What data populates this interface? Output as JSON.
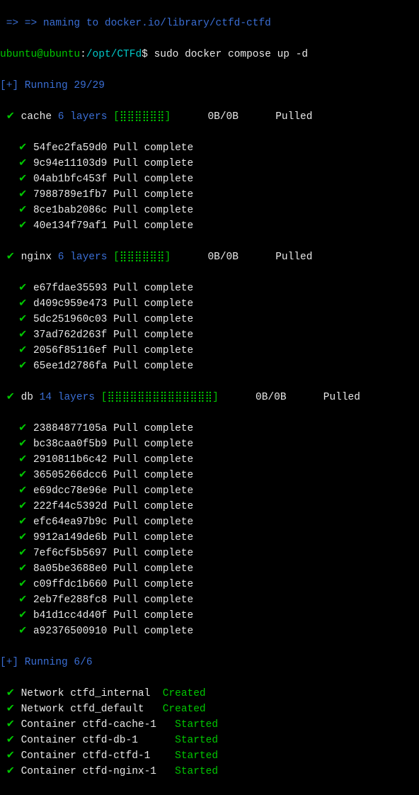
{
  "header": {
    "naming": " => => naming to docker.io/library/ctfd-ctfd",
    "prompt_user": "ubuntu",
    "prompt_at": "@",
    "prompt_host": "ubuntu",
    "prompt_colon": ":",
    "prompt_path": "/opt/CTFd",
    "prompt_dollar": "$ ",
    "command": "sudo docker compose up -d"
  },
  "run1": {
    "text": "[+] Running 29/29"
  },
  "svc": {
    "cache": {
      "name": "cache",
      "layers": "6 layers",
      "bar": "[⣿⣿⣿⣿⣿⣿]",
      "bytes": "0B/0B",
      "status": "Pulled"
    },
    "nginx": {
      "name": "nginx",
      "layers": "6 layers",
      "bar": "[⣿⣿⣿⣿⣿⣿]",
      "bytes": "0B/0B",
      "status": "Pulled"
    },
    "db": {
      "name": "db",
      "layers": "14 layers",
      "bar": "[⣿⣿⣿⣿⣿⣿⣿⣿⣿⣿⣿⣿⣿⣿]",
      "bytes": "0B/0B",
      "status": "Pulled"
    }
  },
  "cache_layers": [
    {
      "id": "54fec2fa59d0",
      "status": "Pull complete"
    },
    {
      "id": "9c94e11103d9",
      "status": "Pull complete"
    },
    {
      "id": "04ab1bfc453f",
      "status": "Pull complete"
    },
    {
      "id": "7988789e1fb7",
      "status": "Pull complete"
    },
    {
      "id": "8ce1bab2086c",
      "status": "Pull complete"
    },
    {
      "id": "40e134f79af1",
      "status": "Pull complete"
    }
  ],
  "nginx_layers": [
    {
      "id": "e67fdae35593",
      "status": "Pull complete"
    },
    {
      "id": "d409c959e473",
      "status": "Pull complete"
    },
    {
      "id": "5dc251960c03",
      "status": "Pull complete"
    },
    {
      "id": "37ad762d263f",
      "status": "Pull complete"
    },
    {
      "id": "2056f85116ef",
      "status": "Pull complete"
    },
    {
      "id": "65ee1d2786fa",
      "status": "Pull complete"
    }
  ],
  "db_layers": [
    {
      "id": "23884877105a",
      "status": "Pull complete"
    },
    {
      "id": "bc38caa0f5b9",
      "status": "Pull complete"
    },
    {
      "id": "2910811b6c42",
      "status": "Pull complete"
    },
    {
      "id": "36505266dcc6",
      "status": "Pull complete"
    },
    {
      "id": "e69dcc78e96e",
      "status": "Pull complete"
    },
    {
      "id": "222f44c5392d",
      "status": "Pull complete"
    },
    {
      "id": "efc64ea97b9c",
      "status": "Pull complete"
    },
    {
      "id": "9912a149de6b",
      "status": "Pull complete"
    },
    {
      "id": "7ef6cf5b5697",
      "status": "Pull complete"
    },
    {
      "id": "8a05be3688e0",
      "status": "Pull complete"
    },
    {
      "id": "c09ffdc1b660",
      "status": "Pull complete"
    },
    {
      "id": "2eb7fe288fc8",
      "status": "Pull complete"
    },
    {
      "id": "b41d1cc4d40f",
      "status": "Pull complete"
    },
    {
      "id": "a92376500910",
      "status": "Pull complete"
    }
  ],
  "run2": {
    "text": "[+] Running 6/6"
  },
  "compose": [
    {
      "kind": "Network",
      "name": "ctfd_internal",
      "status": "Created"
    },
    {
      "kind": "Network",
      "name": "ctfd_default",
      "status": "Created"
    },
    {
      "kind": "Container",
      "name": "ctfd-cache-1",
      "status": "Started"
    },
    {
      "kind": "Container",
      "name": "ctfd-db-1",
      "status": "Started"
    },
    {
      "kind": "Container",
      "name": "ctfd-ctfd-1",
      "status": "Started"
    },
    {
      "kind": "Container",
      "name": "ctfd-nginx-1",
      "status": "Started"
    }
  ],
  "glyphs": {
    "check": "✔"
  }
}
